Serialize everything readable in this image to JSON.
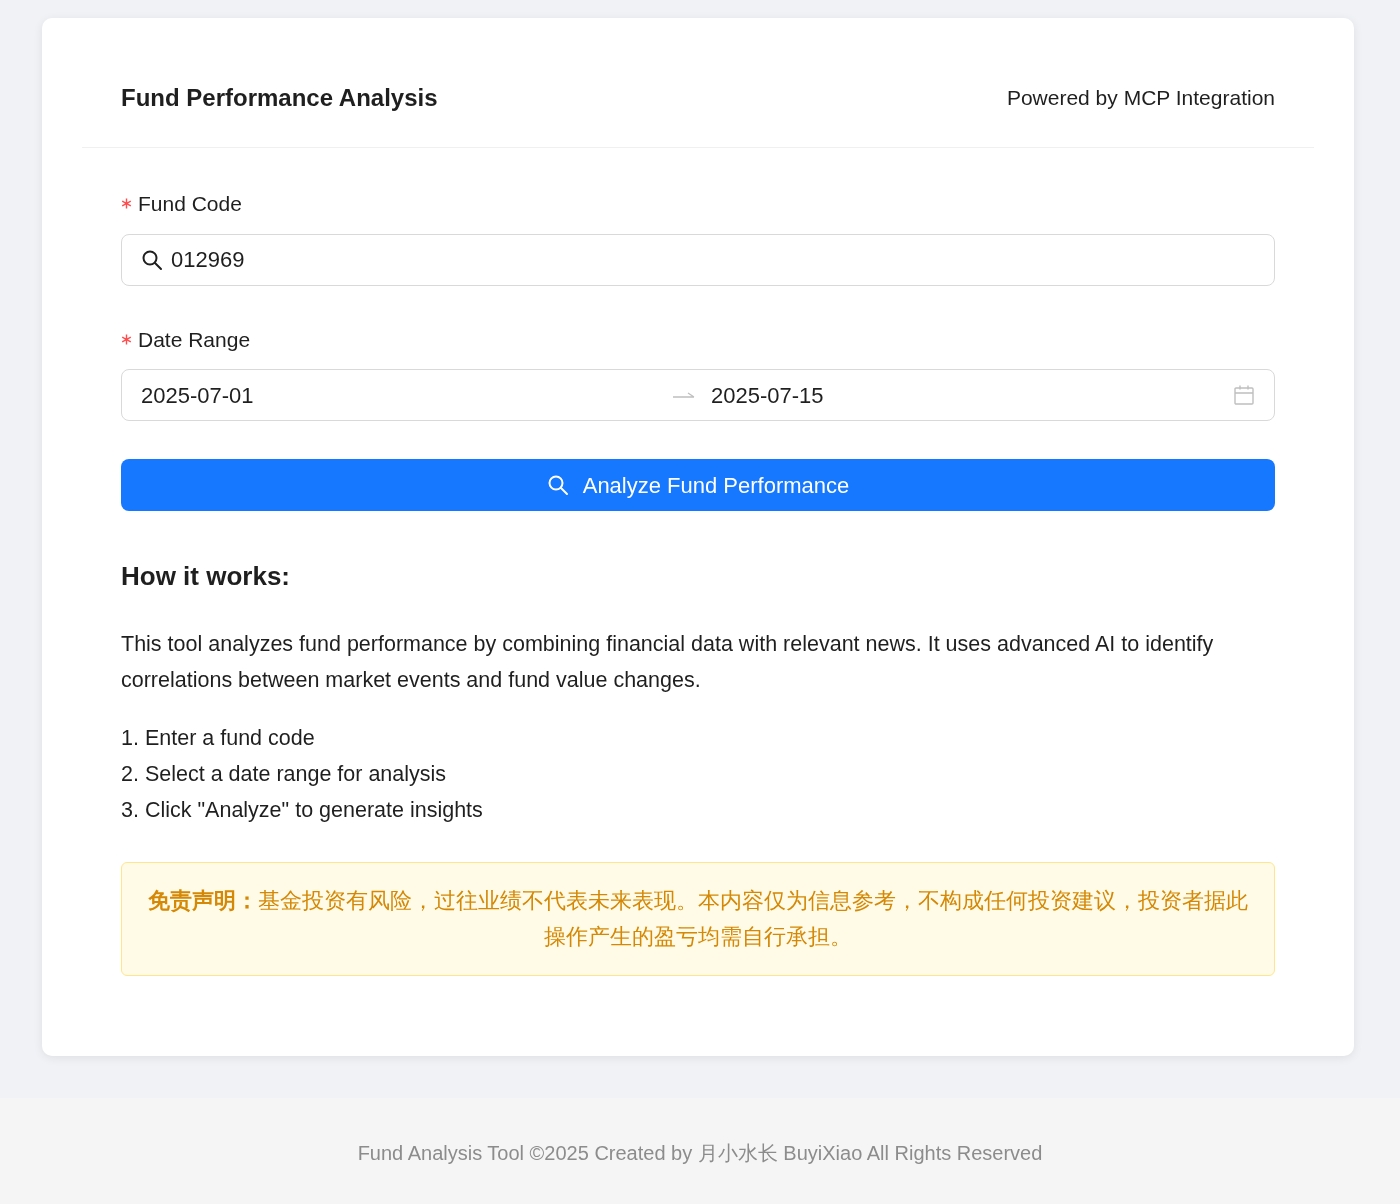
{
  "header": {
    "title": "Fund Performance Analysis",
    "subtitle": "Powered by MCP Integration"
  },
  "fields": [
    {
      "kind": "text",
      "label": "Fund Code",
      "required": true,
      "value": "012969"
    },
    {
      "kind": "daterange",
      "label": "Date Range",
      "required": true,
      "start": "2025-07-01",
      "end": "2025-07-15"
    }
  ],
  "submit": {
    "label": "Analyze Fund Performance"
  },
  "info": {
    "heading": "How it works:",
    "paragraph": "This tool analyzes fund performance by combining financial data with relevant news. It uses advanced AI to identify correlations between market events and fund value changes.",
    "steps": [
      "1. Enter a fund code",
      "2. Select a date range for analysis",
      "3. Click \"Analyze\" to generate insights"
    ]
  },
  "disclaimer": "**免责声明：**基金投资有风险，过往业绩不代表未来表现。本内容仅为信息参考，不构成任何投资建议，投资者据此操作产生的盈亏均需自行承担。",
  "footer": "Fund Analysis Tool ©2025 Created by 月小水长 BuyiXiao All Rights Reserved"
}
